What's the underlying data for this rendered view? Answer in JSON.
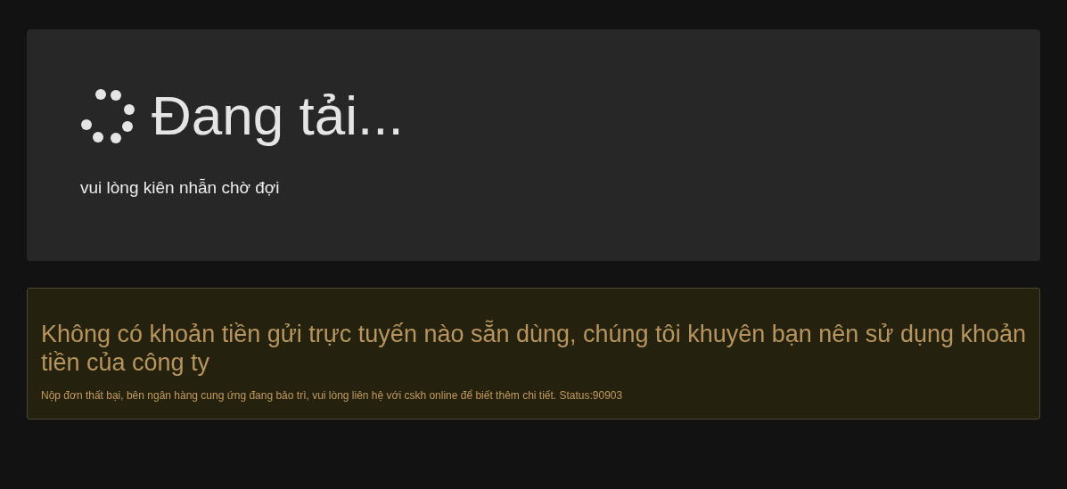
{
  "loading": {
    "title": "Đang tải...",
    "message": "vui lòng kiên nhẫn chờ đợi"
  },
  "alert": {
    "heading": "Không có khoản tiền gửi trực tuyến nào sẵn dùng, chúng tôi khuyên bạn nên sử dụng khoản tiền của công ty",
    "detail": "Nộp đơn thất bại, bên ngân hàng cung ứng đang bảo trì, vui lòng liên hệ với cskh online để biết thêm chi tiết. Status:90903"
  }
}
